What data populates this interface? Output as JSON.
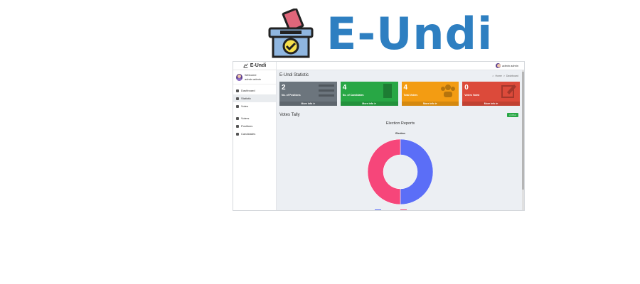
{
  "logo": {
    "title": "E-Undi",
    "icon": "ballot-box-icon"
  },
  "app": {
    "brand": "E-Undi",
    "user": {
      "greeting": "Welcome",
      "name": "admin admin"
    },
    "nav": [
      {
        "label": "Dashboard",
        "icon": "gauge-icon"
      },
      {
        "label": "Statistic",
        "icon": "chart-icon",
        "active": true
      },
      {
        "label": "Votes",
        "icon": "list-icon"
      },
      {
        "label": "Voters",
        "icon": "users-icon"
      },
      {
        "label": "Positions",
        "icon": "tasks-icon"
      },
      {
        "label": "Candidates",
        "icon": "id-card-icon"
      }
    ],
    "topbar": {
      "user_name": "admin admin"
    },
    "page_title": "E-Undi Statistic",
    "breadcrumb": {
      "home": "Home",
      "current": "Dashboard"
    },
    "cards": [
      {
        "number": "2",
        "label": "No. of Positions",
        "more": "More info",
        "color": "#6c757d"
      },
      {
        "number": "4",
        "label": "No. of Candidates",
        "more": "More info",
        "color": "#28a745"
      },
      {
        "number": "4",
        "label": "Total Voters",
        "more": "More info",
        "color": "#f39c12"
      },
      {
        "number": "0",
        "label": "Voters Voted",
        "more": "More info",
        "color": "#dc4a3a"
      }
    ],
    "tally_title": "Votes Tally",
    "print_label": "Print",
    "chart_title": "Election Reports"
  },
  "chart_data": {
    "type": "pie",
    "title": "Election",
    "categories": [
      "MPP STAFF",
      "MPP ISTEM"
    ],
    "values": [
      50,
      50
    ],
    "colors": [
      "#5b6ef7",
      "#f6467a"
    ],
    "donut": true,
    "legend": "bottom"
  }
}
